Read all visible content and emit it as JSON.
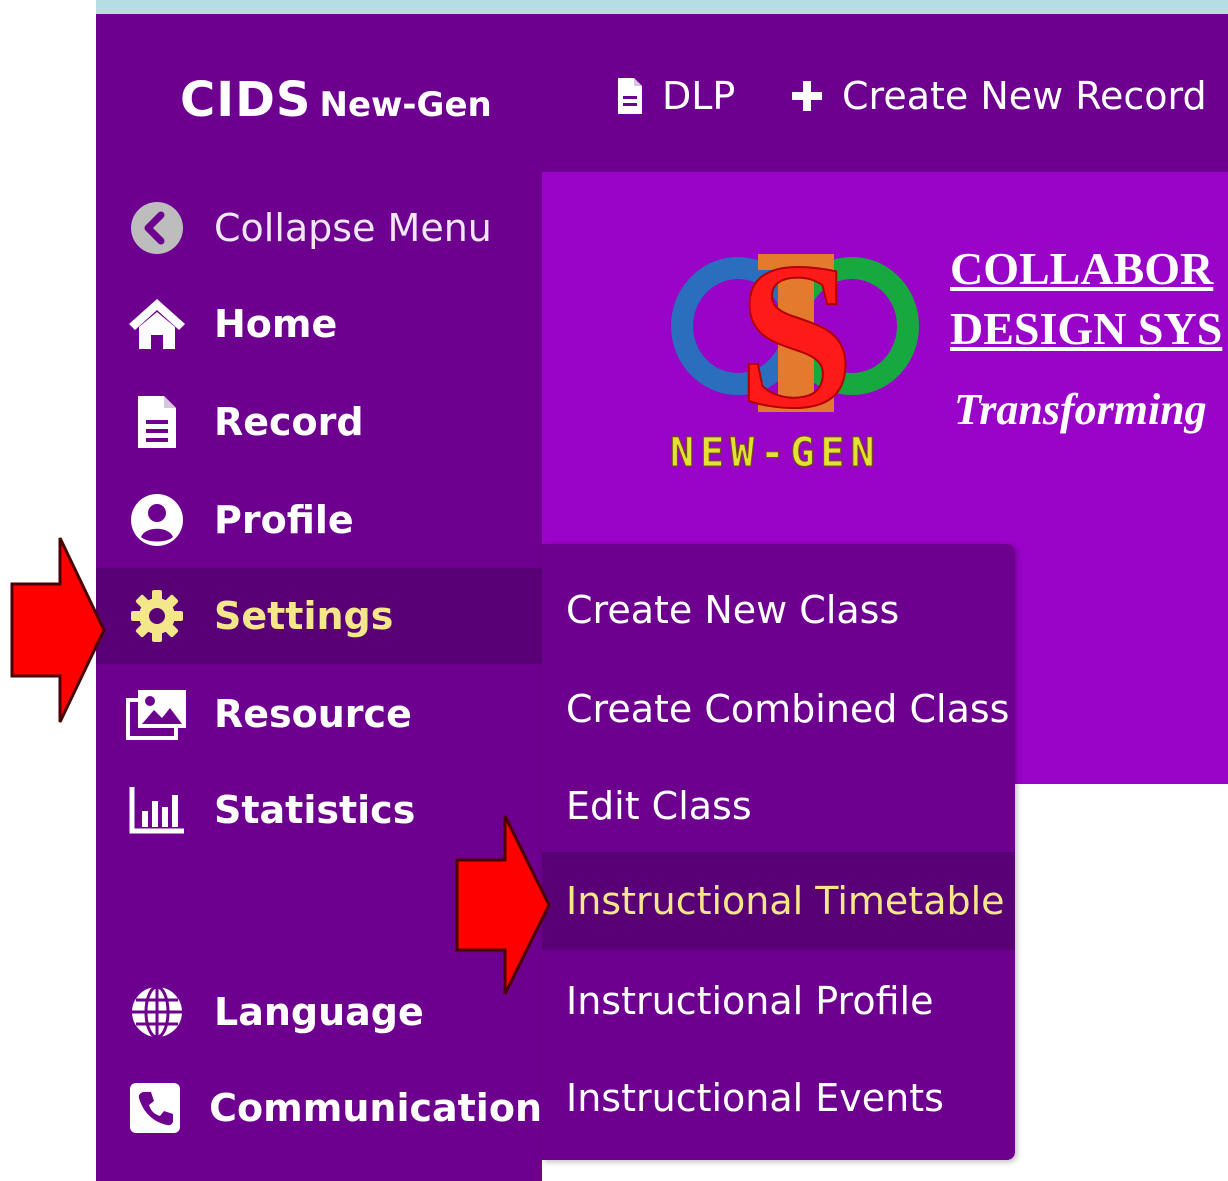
{
  "brand": {
    "name": "CIDS",
    "suffix": "New-Gen"
  },
  "topnav": [
    {
      "label": "DLP",
      "icon": "document-icon"
    },
    {
      "label": "Create New Record",
      "icon": "plus-icon"
    }
  ],
  "sidebar": {
    "items": [
      {
        "label": "Collapse Menu",
        "icon": "chevron-left-circle-icon"
      },
      {
        "label": "Home",
        "icon": "home-icon"
      },
      {
        "label": "Record",
        "icon": "document-icon"
      },
      {
        "label": "Profile",
        "icon": "user-circle-icon"
      },
      {
        "label": "Settings",
        "icon": "gear-icon",
        "active": true
      },
      {
        "label": "Resource",
        "icon": "images-icon"
      },
      {
        "label": "Statistics",
        "icon": "bar-chart-icon"
      },
      {
        "label": "Language",
        "icon": "globe-icon"
      },
      {
        "label": "Communication",
        "icon": "phone-icon"
      }
    ]
  },
  "banner": {
    "title_line1": "COLLABOR",
    "title_line2": "DESIGN SYS",
    "tagline": "Transforming",
    "logo_text": "NEW-GEN",
    "logo_letters": "CIDS"
  },
  "settings_menu": {
    "items": [
      {
        "label": "Create New Class"
      },
      {
        "label": "Create Combined Class"
      },
      {
        "label": "Edit Class"
      },
      {
        "label": "Instructional Timetable",
        "active": true
      },
      {
        "label": "Instructional Profile"
      },
      {
        "label": "Instructional Events"
      }
    ]
  },
  "colors": {
    "sidebar": "#6d008f",
    "content": "#9a03c8",
    "active_bg": "#5a0077",
    "active_text": "#f3e78a",
    "arrow": "#ff0000"
  }
}
